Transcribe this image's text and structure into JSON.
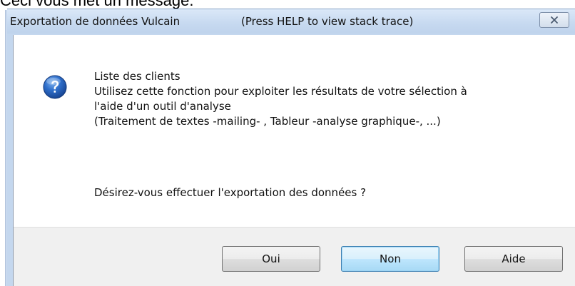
{
  "page": {
    "caption": "Ceci vous met un message."
  },
  "window": {
    "title": "Exportation de données Vulcain",
    "hint": "(Press HELP to view stack trace)",
    "close_glyph": "✕"
  },
  "dialog": {
    "icon": "question-icon",
    "message_lines": [
      "Liste des clients",
      "Utilisez cette fonction pour exploiter les résultats de votre sélection à",
      "l'aide d'un outil d'analyse",
      "(Traitement de textes -mailing- , Tableur -analyse graphique-, ...)"
    ],
    "question": "Désirez-vous effectuer l'exportation des données ?"
  },
  "buttons": {
    "yes": "Oui",
    "no": "Non",
    "help": "Aide"
  },
  "colors": {
    "icon_blue": "#1f5fb8",
    "default_button_border": "#3c7fb1",
    "title_bar": "#c6d9f0"
  }
}
